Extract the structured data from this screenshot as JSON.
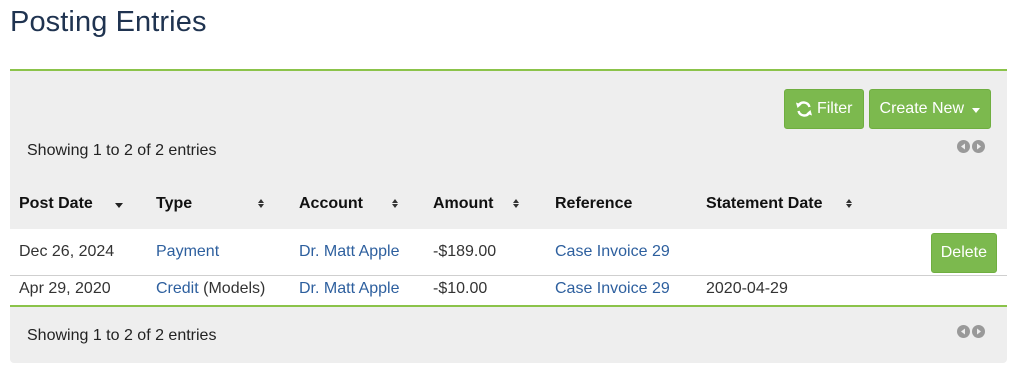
{
  "page": {
    "title": "Posting Entries"
  },
  "toolbar": {
    "filter_label": "Filter",
    "create_label": "Create New"
  },
  "info": {
    "top": "Showing 1 to 2 of 2 entries",
    "bottom": "Showing 1 to 2 of 2 entries"
  },
  "table": {
    "headers": [
      "Post Date",
      "Type",
      "Account",
      "Amount",
      "Reference",
      "Statement Date"
    ],
    "rows": [
      {
        "post_date": "Dec 26, 2024",
        "type": "Payment",
        "type_note": "",
        "account": "Dr. Matt Apple",
        "amount": "-$189.00",
        "reference": "Case Invoice 29",
        "statement_date": "",
        "action": "Delete"
      },
      {
        "post_date": "Apr 29, 2020",
        "type": "Credit",
        "type_note": "(Models)",
        "account": "Dr. Matt Apple",
        "amount": "-$10.00",
        "reference": "Case Invoice 29",
        "statement_date": "2020-04-29",
        "action": ""
      }
    ]
  },
  "icons": {
    "filter": "refresh-icon",
    "pager_prev": "arrow-left-circle-icon",
    "pager_next": "arrow-right-circle-icon"
  },
  "colors": {
    "accent_green": "#7cb94e",
    "link_blue": "#2d5f9e",
    "title_navy": "#1f3350"
  }
}
